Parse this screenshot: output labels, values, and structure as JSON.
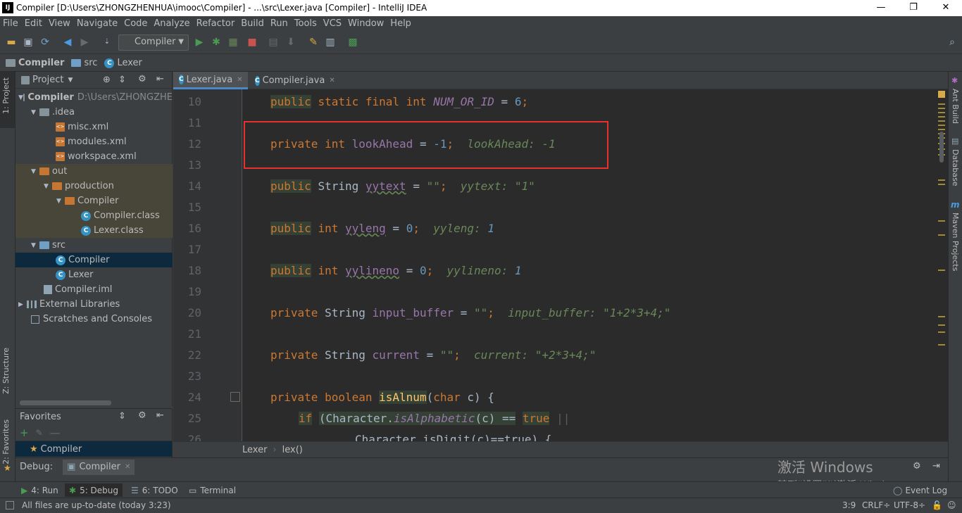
{
  "window": {
    "title": "Compiler [D:\\Users\\ZHONGZHENHUA\\imooc\\Compiler] - ...\\src\\Lexer.java [Compiler] - IntelliJ IDEA",
    "logo": "IJ",
    "min": "—",
    "max": "❐",
    "close": "✕"
  },
  "menu": [
    "File",
    "Edit",
    "View",
    "Navigate",
    "Code",
    "Analyze",
    "Refactor",
    "Build",
    "Run",
    "Tools",
    "VCS",
    "Window",
    "Help"
  ],
  "toolbar": {
    "run_config": "Compiler"
  },
  "breadcrumb": [
    "Compiler",
    "src",
    "Lexer"
  ],
  "left_stripe": {
    "project": "1: Project",
    "structure": "Z: Structure",
    "favorites": "2: Favorites"
  },
  "project_panel": {
    "title": "Project",
    "tree": [
      {
        "label": "Compiler",
        "extra": "D:\\Users\\ZHONGZHE"
      },
      {
        "label": ".idea"
      },
      {
        "label": "misc.xml"
      },
      {
        "label": "modules.xml"
      },
      {
        "label": "workspace.xml"
      },
      {
        "label": "out"
      },
      {
        "label": "production"
      },
      {
        "label": "Compiler"
      },
      {
        "label": "Compiler.class"
      },
      {
        "label": "Lexer.class"
      },
      {
        "label": "src"
      },
      {
        "label": "Compiler"
      },
      {
        "label": "Lexer"
      },
      {
        "label": "Compiler.iml"
      },
      {
        "label": "External Libraries"
      },
      {
        "label": "Scratches and Consoles"
      }
    ]
  },
  "favorites": {
    "title": "Favorites",
    "item": "Compiler"
  },
  "tabs": [
    {
      "label": "Lexer.java",
      "active": true
    },
    {
      "label": "Compiler.java",
      "active": false
    }
  ],
  "editor": {
    "line_numbers": [
      "10",
      "11",
      "12",
      "13",
      "14",
      "15",
      "16",
      "17",
      "18",
      "19",
      "20",
      "21",
      "22",
      "23",
      "24",
      "25",
      "26"
    ],
    "lines": {
      "l10": {
        "kw1": "public",
        "kw2": "static final int",
        "name": "NUM_OR_ID",
        "op": "=",
        "val": "6",
        "end": ";"
      },
      "l12": {
        "kw": "private int",
        "name": "lookAhead",
        "op": "=",
        "val": "-1",
        "end": ";",
        "hint_name": "lookAhead:",
        "hint_val": "-1"
      },
      "l14": {
        "kw": "public",
        "type": "String",
        "name": "yytext",
        "op": "=",
        "val": "\"\"",
        "end": ";",
        "hint_name": "yytext:",
        "hint_val": "\"1\""
      },
      "l16": {
        "kw": "public",
        "type": "int",
        "name": "yyleng",
        "op": "=",
        "val": "0",
        "end": ";",
        "hint_name": "yyleng:",
        "hint_val": "1"
      },
      "l18": {
        "kw": "public",
        "type": "int",
        "name": "yylineno",
        "op": "=",
        "val": "0",
        "end": ";",
        "hint_name": "yylineno:",
        "hint_val": "1"
      },
      "l20": {
        "kw": "private",
        "type": "String",
        "name": "input_buffer",
        "op": "=",
        "val": "\"\"",
        "end": ";",
        "hint_name": "input_buffer:",
        "hint_val": "\"1+2*3+4;\""
      },
      "l22": {
        "kw": "private",
        "type": "String",
        "name": "current",
        "op": "=",
        "val": "\"\"",
        "end": ";",
        "hint_name": "current:",
        "hint_val": "\"+2*3+4;\""
      },
      "l24": {
        "kw": "private boolean",
        "name": "isAlnum",
        "open": "(",
        "ptype": "char",
        "param": "c) {"
      },
      "l25": {
        "kw": "if",
        "open": "(Character.",
        "call": "isAlphabetic",
        "args": "(c) ==",
        "val": "true",
        "tail": "||"
      },
      "l26": {
        "text": "Character.isDigit(c)==true) {"
      }
    }
  },
  "editor_breadcrumb": [
    "Lexer",
    "lex()"
  ],
  "right_stripe": [
    "Ant Build",
    "Database",
    "Maven Projects"
  ],
  "debug": {
    "label": "Debug:",
    "tab": "Compiler"
  },
  "bottom_tabs": [
    {
      "label": "4: Run"
    },
    {
      "label": "5: Debug"
    },
    {
      "label": "6: TODO"
    },
    {
      "label": "Terminal"
    },
    {
      "label": "Event Log"
    }
  ],
  "status": {
    "message": "All files are up-to-date (today 3:23)",
    "position": "3:9",
    "line_sep": "CRLF÷",
    "encoding": "UTF-8÷"
  },
  "watermark": {
    "line1": "激活 Windows",
    "line2": "转到“设置”以激活 Windows。"
  }
}
